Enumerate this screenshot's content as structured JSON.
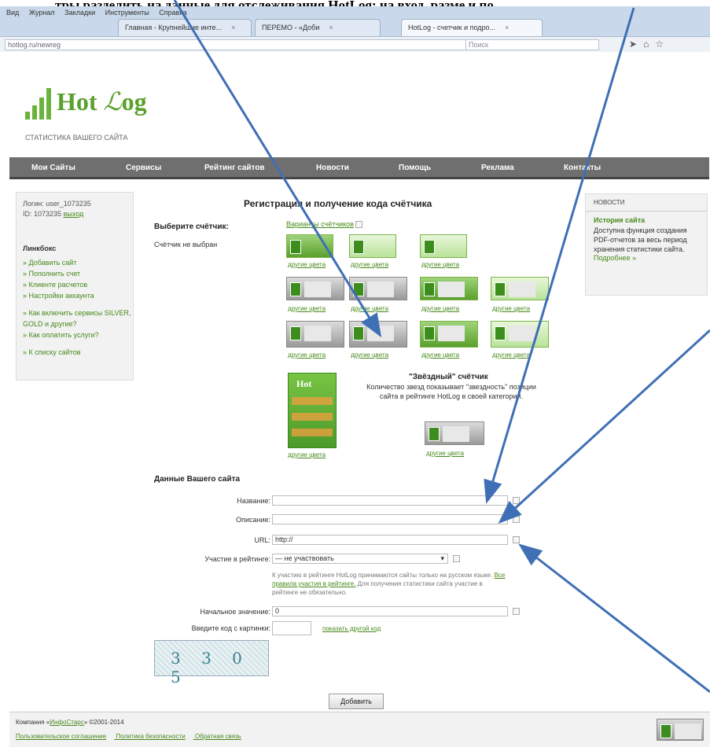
{
  "top_text": "тры разделить на данные для отслеживания HotLog: на вход, разме и по",
  "browser": {
    "menu": [
      "Вид",
      "Журнал",
      "Закладки",
      "Инструменты",
      "Справка"
    ],
    "tabs": [
      {
        "label": "Главная - Крупнейшие инте..."
      },
      {
        "label": "ПЕРЕМО - «Доби"
      },
      {
        "label": "HotLog - счетчик и подро..."
      }
    ],
    "url": "hotlog.ru/newreg",
    "search_placeholder": "Поиск"
  },
  "logo": {
    "brand": "Hot",
    "brand2": "og",
    "tagline": "СТАТИСТИКА ВАШЕГО САЙТА"
  },
  "nav": [
    "Мои Сайты",
    "Сервисы",
    "Рейтинг сайтов",
    "Новости",
    "Помощь",
    "Реклама",
    "Контакты"
  ],
  "sidebar": {
    "login_line": "Логин: user_1073235",
    "id_line": "ID: 1073235",
    "exit": "выход",
    "title": "Линкбокс",
    "links": [
      "Добавить сайт",
      "Пополнить счет",
      "Клиенте расчетов",
      "Настройки аккаунта",
      "Как включить сервисы SILVER, GOLD и другие?",
      "Как оплатить услуги?",
      "К списку сайтов"
    ]
  },
  "news": {
    "header": "НОВОСТИ",
    "title": "История сайта",
    "body": "Доступна функция создания PDF-отчетов за весь период хранения статистики сайта.",
    "more": "Подробнее »"
  },
  "main": {
    "title": "Регистрация и получение кода счётчика",
    "choose_label": "Выберите счётчик:",
    "variants_link": "Варианты счётчиков",
    "none_selected": "Счётчик не выбран",
    "other_colors": "другие цвета",
    "star_title": "\"Звёздный\" счётчик",
    "star_desc": "Количество звезд показывает \"звездность\" позиции сайта в рейтинге HotLog в своей категории."
  },
  "form": {
    "section_title": "Данные Вашего сайта",
    "name_label": "Название:",
    "desc_label": "Описание:",
    "url_label": "URL:",
    "url_value": "http://",
    "rating_label": "Участие в рейтинге:",
    "rating_value": "— не участвовать",
    "note_start": "К участию в рейтинге HotLog принимаются сайты только на русском языке.",
    "note_link": "Все правила участия в рейтинге.",
    "note_end": "Для получения статистики сайта участие в рейтинге не обязательно.",
    "initial_label": "Начальное значение:",
    "initial_value": "0",
    "captcha_label": "Введите код с картинки:",
    "captcha_text": "3 3 0 5",
    "other_code": "показать другой код",
    "submit": "Добавить"
  },
  "footer": {
    "company_pre": "Компания «",
    "company_link": "ИнфоСтарс",
    "company_post": "» ©2001-2014",
    "links": [
      "Пользовательское соглашение",
      "Политика безопасности",
      "Обратная связь"
    ]
  }
}
